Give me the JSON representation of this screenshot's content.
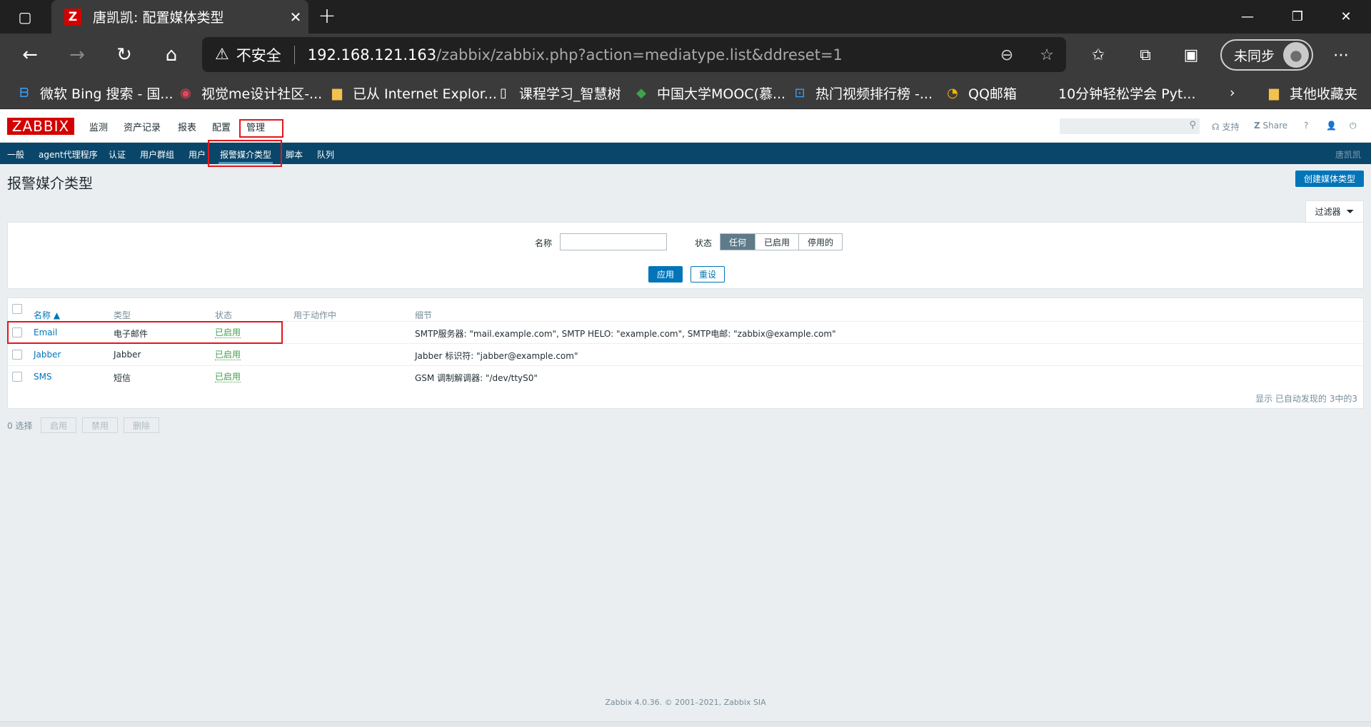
{
  "browser": {
    "tab_title": "唐凯凯: 配置媒体类型",
    "tab_favicon": "Z",
    "address": {
      "insecure_label": "不安全",
      "host": "192.168.121.163",
      "path": "/zabbix/zabbix.php?action=mediatype.list&ddreset=1"
    },
    "profile_label": "未同步",
    "bookmarks": [
      {
        "label": "微软 Bing 搜索 - 国...",
        "icon": "bing-icon"
      },
      {
        "label": "视觉me设计社区-...",
        "icon": "eye-icon"
      },
      {
        "label": "已从 Internet Explor...",
        "icon": "folder-icon"
      },
      {
        "label": "课程学习_智慧树",
        "icon": "page-icon"
      },
      {
        "label": "中国大学MOOC(慕...",
        "icon": "mooc-icon"
      },
      {
        "label": "热门视频排行榜 -...",
        "icon": "bilibili-icon"
      },
      {
        "label": "QQ邮箱",
        "icon": "qqmail-icon"
      },
      {
        "label": "10分钟轻松学会 Pyt...",
        "icon": "none"
      }
    ],
    "other_bookmarks": "其他收藏夹"
  },
  "zabbix": {
    "logo": "ZABBIX",
    "menu": [
      "监测",
      "资产记录",
      "报表",
      "配置",
      "管理"
    ],
    "top_right": {
      "support": "支持",
      "share": "Share",
      "help": "?"
    },
    "submenu": [
      "一般",
      "agent代理程序",
      "认证",
      "用户群组",
      "用户",
      "报警媒介类型",
      "脚本",
      "队列"
    ],
    "submenu_user": "唐凯凯",
    "page_title": "报警媒介类型",
    "create_button": "创建媒体类型",
    "filter": {
      "tab_label": "过滤器",
      "name_label": "名称",
      "name_value": "",
      "status_label": "状态",
      "status_options": [
        "任何",
        "已启用",
        "停用的"
      ],
      "status_selected": "任何",
      "apply": "应用",
      "reset": "重设"
    },
    "table": {
      "headers": [
        "名称 ▲",
        "类型",
        "状态",
        "用于动作中",
        "细节"
      ],
      "rows": [
        {
          "name": "Email",
          "type": "电子邮件",
          "status": "已启用",
          "used": "",
          "details": "SMTP服务器: \"mail.example.com\", SMTP HELO: \"example.com\", SMTP电邮: \"zabbix@example.com\""
        },
        {
          "name": "Jabber",
          "type": "Jabber",
          "status": "已启用",
          "used": "",
          "details": "Jabber 标识符: \"jabber@example.com\""
        },
        {
          "name": "SMS",
          "type": "短信",
          "status": "已启用",
          "used": "",
          "details": "GSM 调制解调器: \"/dev/ttyS0\""
        }
      ],
      "footer": "显示 已自动发现的 3中的3"
    },
    "bulk": {
      "selected": "0 选择",
      "enable": "启用",
      "disable": "禁用",
      "delete": "删除"
    },
    "footer": "Zabbix 4.0.36. © 2001–2021, Zabbix SIA"
  },
  "colors": {
    "zabbix_red": "#d40000",
    "submenu_bg": "#0a466a",
    "link_blue": "#0275b8",
    "enabled_green": "#429e47",
    "highlight_red": "#e2161b"
  }
}
